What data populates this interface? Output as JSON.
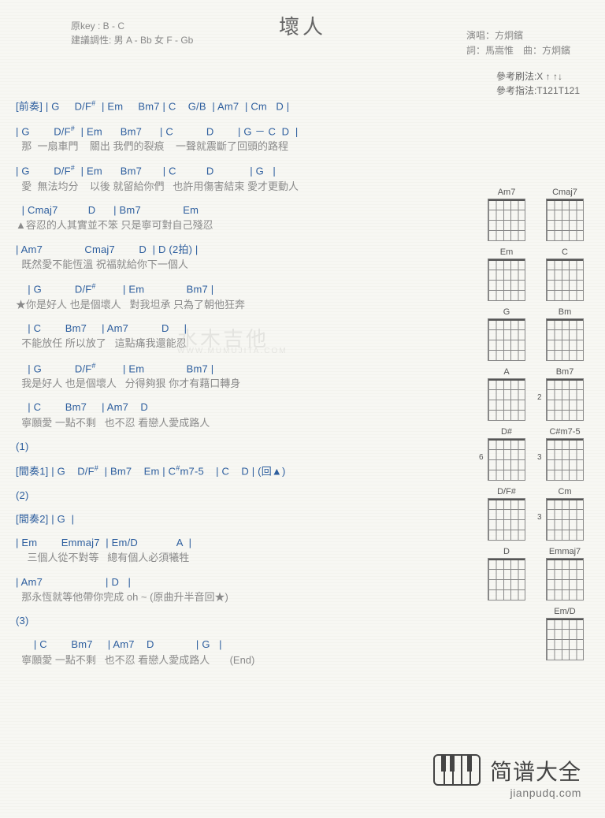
{
  "title": "壞人",
  "meta_left": {
    "key": "原key : B - C",
    "suggest": "建議調性: 男 A - Bb 女 F - Gb"
  },
  "meta_right": {
    "singer": "演唱：方炯鑌",
    "credits": "詞：馬嵩惟　曲：方炯鑌"
  },
  "strum": {
    "l1": "參考刷法:X ↑ ↑↓",
    "l2": "參考指法:T121T121"
  },
  "lines": [
    {
      "c": "[前奏] | G     D/F#  | Em     Bm7 | C    G/B  | Am7  | Cm   D |",
      "y": ""
    },
    {
      "c": "| G        D/F#  | Em      Bm7      | C           D        | G － C  D  |",
      "y": "  那  一扇車門    關出 我們的裂痕    一聲就震斷了回頭的路程"
    },
    {
      "c": "| G        D/F#  | Em      Bm7       | C          D            | G   |",
      "y": "  愛  無法均分    以後 就留給你們   也許用傷害結束 愛才更動人"
    },
    {
      "c": "  | Cmaj7          D      | Bm7              Em",
      "y": "▲容忍的人其實並不笨 只是寧可對自己殘忍"
    },
    {
      "c": "| Am7              Cmaj7        D  | D (2拍) |",
      "y": "  既然愛不能恆溫 祝福就給你下一個人"
    },
    {
      "c": "    | G           D/F#         | Em              Bm7 |",
      "y": "★你是好人 也是個壞人   對我坦承 只為了朝他狂奔"
    },
    {
      "c": "    | C        Bm7     | Am7           D     |",
      "y": "  不能放任 所以放了   這點痛我還能忍"
    },
    {
      "c": "    | G           D/F#         | Em              Bm7 |",
      "y": "  我是好人 也是個壞人   分得夠狠 你才有藉口轉身"
    },
    {
      "c": "    | C        Bm7     | Am7    D",
      "y": "  寧願愛 一點不剩   也不忍 看戀人愛成路人"
    },
    {
      "c": "(1)",
      "y": ""
    },
    {
      "c": "[間奏1] | G    D/F#  | Bm7    Em | C#m7-5    | C    D | (回▲)",
      "y": ""
    },
    {
      "c": "(2)",
      "y": ""
    },
    {
      "c": "[間奏2] | G  |",
      "y": ""
    },
    {
      "c": "| Em        Emmaj7  | Em/D             A  |",
      "y": "    三個人從不對等   總有個人必須犧牲"
    },
    {
      "c": "| Am7                     | D   |",
      "y": "  那永恆就等他帶你完成 oh ~ (原曲升半音回★)"
    },
    {
      "c": "(3)",
      "y": ""
    },
    {
      "c": "      | C        Bm7     | Am7    D              | G   |",
      "y": "  寧願愛 一點不剩   也不忍 看戀人愛成路人       (End)"
    }
  ],
  "watermark": {
    "big": "水木吉他",
    "small": "WWW.MUMUJITA.COM"
  },
  "diagramsTitle": "",
  "diagrams": [
    {
      "name": "Am7",
      "base": ""
    },
    {
      "name": "Cmaj7",
      "base": ""
    },
    {
      "name": "Em",
      "base": ""
    },
    {
      "name": "C",
      "base": ""
    },
    {
      "name": "G",
      "base": ""
    },
    {
      "name": "Bm",
      "base": ""
    },
    {
      "name": "A",
      "base": ""
    },
    {
      "name": "Bm7",
      "base": "2"
    },
    {
      "name": "D#",
      "base": "6"
    },
    {
      "name": "C#m7-5",
      "base": "3"
    },
    {
      "name": "D/F#",
      "base": ""
    },
    {
      "name": "Cm",
      "base": "3"
    },
    {
      "name": "D",
      "base": ""
    },
    {
      "name": "Emmaj7",
      "base": ""
    },
    {
      "name": "Em/D",
      "base": ""
    }
  ],
  "logo": {
    "big": "简谱大全",
    "url": "jianpudq.com"
  }
}
